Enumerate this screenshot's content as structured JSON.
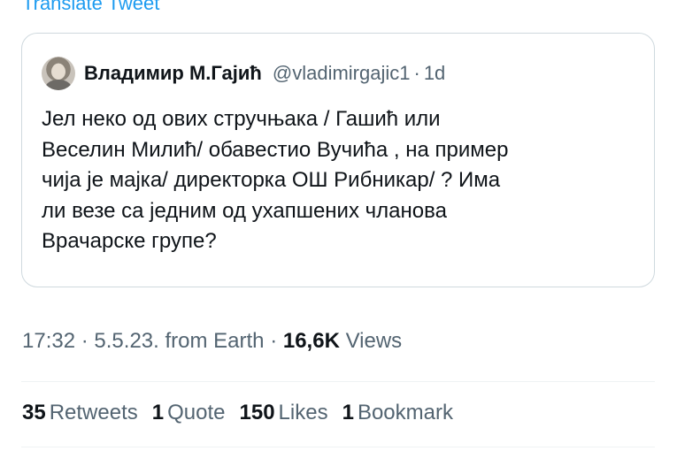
{
  "translate_link": "Translate Tweet",
  "quote": {
    "name": "Владимир М.Гајић",
    "handle": "@vladimirgajic1",
    "separator": "·",
    "time": "1d",
    "text_lines": [
      "Јел неко од ових стручњака / Гашић или",
      "Веселин Милић/ обавестио Вучића , на пример",
      "чија је мајка/ директорка ОШ Рибникар/ ? Има",
      "ли везе са једним од ухапшених чланова",
      "Врачарске групе?"
    ]
  },
  "meta": {
    "time": "17:32",
    "sep1": "·",
    "date": "5.5.23.",
    "source": "from Earth",
    "sep2": "·",
    "views_count": "16,6K",
    "views_label": "Views"
  },
  "stats": {
    "retweets_count": "35",
    "retweets_label": "Retweets",
    "quotes_count": "1",
    "quotes_label": "Quote",
    "likes_count": "150",
    "likes_label": "Likes",
    "bookmarks_count": "1",
    "bookmarks_label": "Bookmark"
  },
  "colors": {
    "link": "#1d9bf0",
    "secondary_text": "#536471",
    "primary_text": "#0f1419",
    "border": "#cfd9de"
  }
}
